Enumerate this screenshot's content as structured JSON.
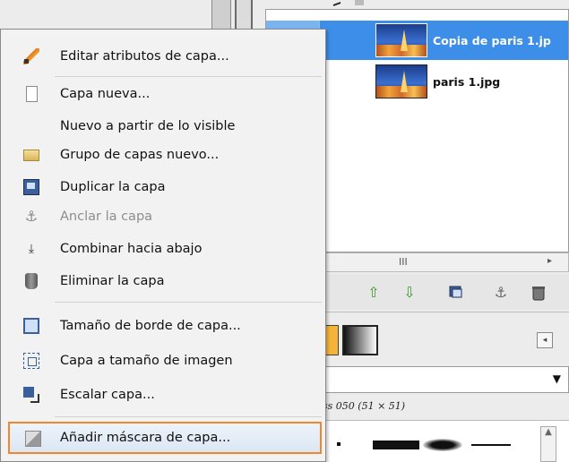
{
  "layers_panel": {
    "layers": [
      {
        "name": "Copia de paris 1.jp",
        "selected": true
      },
      {
        "name": "paris 1.jpg",
        "selected": false
      }
    ],
    "scroll_grip": "III",
    "scroll_arrow": "▸",
    "toolbar_icons": [
      "raise-layer-icon",
      "lower-layer-icon",
      "duplicate-layer-icon",
      "anchor-layer-icon",
      "delete-layer-icon"
    ]
  },
  "brushes_panel": {
    "combo_caret": "▼",
    "caption": "ss 050 (51 × 51)",
    "scroll_arrow": "▲",
    "nav_icon": "◂"
  },
  "context_menu": {
    "items": [
      {
        "label": "Editar atributos de capa...",
        "icon": "pencil-icon",
        "enabled": true
      },
      {
        "label": "Capa nueva...",
        "icon": "new-page-icon",
        "enabled": true
      },
      {
        "label": "Nuevo a partir de lo visible",
        "icon": "",
        "enabled": true
      },
      {
        "label": "Grupo de capas nuevo...",
        "icon": "folder-icon",
        "enabled": true
      },
      {
        "label": "Duplicar la capa",
        "icon": "duplicate-icon",
        "enabled": true
      },
      {
        "label": "Anclar la capa",
        "icon": "anchor-icon",
        "enabled": false
      },
      {
        "label": "Combinar hacia abajo",
        "icon": "merge-down-icon",
        "enabled": true
      },
      {
        "label": "Eliminar la capa",
        "icon": "trash-icon",
        "enabled": true
      },
      {
        "label": "Tamaño de borde de capa...",
        "icon": "layer-boundary-icon",
        "enabled": true
      },
      {
        "label": "Capa a tamaño de imagen",
        "icon": "layer-to-image-icon",
        "enabled": true
      },
      {
        "label": "Escalar capa...",
        "icon": "scale-icon",
        "enabled": true
      },
      {
        "label": "Añadir máscara de capa...",
        "icon": "add-mask-icon",
        "enabled": true,
        "highlighted": true
      }
    ]
  },
  "colors": {
    "selection_blue": "#3d8ee8",
    "highlight_orange": "#f0862e"
  }
}
